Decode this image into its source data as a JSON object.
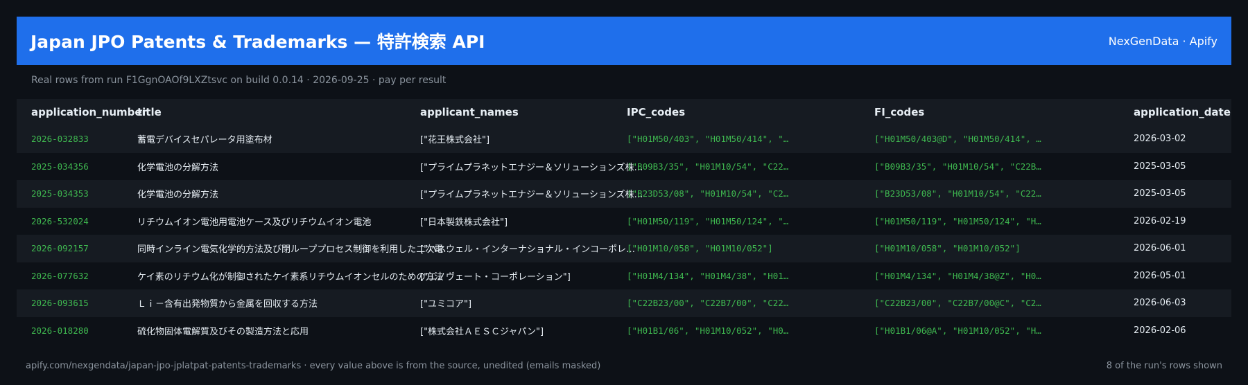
{
  "header": {
    "title": "Japan JPO Patents & Trademarks — 特許検索 API",
    "brand": "NexGenData · Apify"
  },
  "subtitle": "Real rows from run F1GgnOAOf9LXZtsvc on build 0.0.14 · 2026-09-25 · pay per result",
  "table": {
    "columns": [
      "application_number",
      "title",
      "applicant_names",
      "IPC_codes",
      "FI_codes",
      "application_date"
    ],
    "rows": [
      [
        "2026-032833",
        "蓄電デバイスセパレータ用塗布材",
        "[\"花王株式会社\"]",
        "[\"H01M50/403\", \"H01M50/414\", \"…",
        "[\"H01M50/403@D\", \"H01M50/414\", …",
        "2026-03-02"
      ],
      [
        "2025-034356",
        "化学電池の分解方法",
        "[\"プライムプラネットエナジー＆ソリューションズ株…",
        "[\"B09B3/35\", \"H01M10/54\", \"C22…",
        "[\"B09B3/35\", \"H01M10/54\", \"C22B…",
        "2025-03-05"
      ],
      [
        "2025-034353",
        "化学電池の分解方法",
        "[\"プライムプラネットエナジー＆ソリューションズ株…",
        "[\"B23D53/08\", \"H01M10/54\", \"C2…",
        "[\"B23D53/08\", \"H01M10/54\", \"C22…",
        "2025-03-05"
      ],
      [
        "2026-532024",
        "リチウムイオン電池用電池ケース及びリチウムイオン電池",
        "[\"日本製鉄株式会社\"]",
        "[\"H01M50/119\", \"H01M50/124\", \"…",
        "[\"H01M50/119\", \"H01M50/124\", \"H…",
        "2026-02-19"
      ],
      [
        "2026-092157",
        "同時インライン電気化学的方法及び閉ループプロセス制御を利用した二次電…",
        "[\"ハネウェル・インターナショナル・インコーポレ…",
        "[\"H01M10/058\", \"H01M10/052\"]",
        "[\"H01M10/058\", \"H01M10/052\"]",
        "2026-06-01"
      ],
      [
        "2026-077632",
        "ケイ素のリチウム化が制御されたケイ素系リチウムイオンセルのための方法",
        "[\"エノヴェート・コーポレーション\"]",
        "[\"H01M4/134\", \"H01M4/38\", \"H01…",
        "[\"H01M4/134\", \"H01M4/38@Z\", \"H0…",
        "2026-05-01"
      ],
      [
        "2026-093615",
        "Ｌｉ－含有出発物質から金属を回収する方法",
        "[\"ユミコア\"]",
        "[\"C22B23/00\", \"C22B7/00\", \"C22…",
        "[\"C22B23/00\", \"C22B7/00@C\", \"C2…",
        "2026-06-03"
      ],
      [
        "2026-018280",
        "硫化物固体電解質及びその製造方法と応用",
        "[\"株式会社ＡＥＳＣジャパン\"]",
        "[\"H01B1/06\", \"H01M10/052\", \"H0…",
        "[\"H01B1/06@A\", \"H01M10/052\", \"H…",
        "2026-02-06"
      ]
    ]
  },
  "footer": {
    "left": "apify.com/nexgendata/japan-jpo-jplatpat-patents-trademarks  ·  every value above is from the source, unedited (emails masked)",
    "right": "8 of the run's rows shown"
  }
}
